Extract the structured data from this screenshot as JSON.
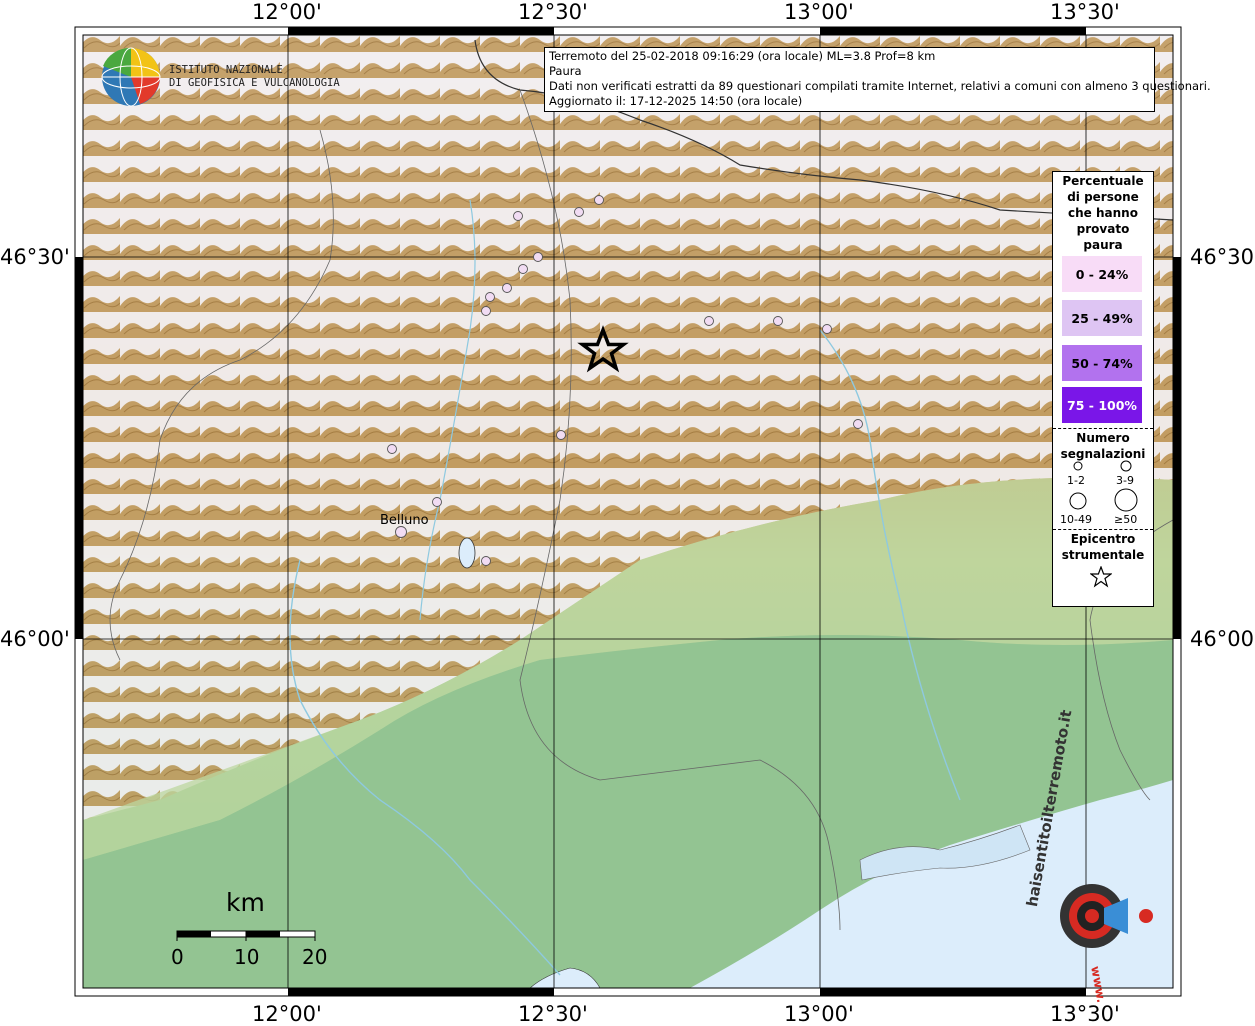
{
  "map": {
    "axis_top": [
      "12°00'",
      "12°30'",
      "13°00'",
      "13°30'"
    ],
    "axis_bottom": [
      "12°00'",
      "12°30'",
      "13°00'",
      "13°30'"
    ],
    "axis_left": [
      "46°30'",
      "46°00'"
    ],
    "axis_right": [
      "46°30'",
      "46°00'"
    ],
    "city_label": "Belluno"
  },
  "logo": {
    "line1": "ISTITUTO NAZIONALE",
    "line2": "DI GEOFISICA E VULCANOLOGIA"
  },
  "info": {
    "line1": "Terremoto del 25-02-2018 09:16:29 (ora locale) ML=3.8 Prof=8 km",
    "line2": "Paura",
    "line3": "Dati non verificati estratti da 89 questionari compilati tramite Internet, relativi a comuni con almeno 3 questionari.",
    "line4": "Aggiornato il: 17-12-2025 14:50 (ora locale)"
  },
  "legend": {
    "title_lines": [
      "Percentuale",
      "di persone",
      "che hanno",
      "provato",
      "paura"
    ],
    "classes": [
      {
        "label": "0 - 24%",
        "color": "#f8dcf7",
        "text_color": "#000000"
      },
      {
        "label": "25 - 49%",
        "color": "#dec5f3",
        "text_color": "#000000"
      },
      {
        "label": "50 - 74%",
        "color": "#b272ee",
        "text_color": "#000000"
      },
      {
        "label": "75 - 100%",
        "color": "#7a16e8",
        "text_color": "#ffffff"
      }
    ],
    "count_title_lines": [
      "Numero",
      "segnalazioni"
    ],
    "count_labels": [
      "1-2",
      "3-9",
      "10-49",
      "≥50"
    ],
    "epicenter_lines": [
      "Epicentro",
      "strumentale"
    ]
  },
  "scale": {
    "unit": "km",
    "ticks": [
      "0",
      "10",
      "20"
    ]
  },
  "watermark": {
    "text": "haisentitoilterremoto.it",
    "url": "www."
  },
  "colors": {
    "point_fill": "#f1dcf3",
    "lowland": "#93c492",
    "hills": "#c4d8a0",
    "mountain": "#b8893e",
    "snow": "#f4f1f4",
    "sea": "#dcedfb"
  }
}
